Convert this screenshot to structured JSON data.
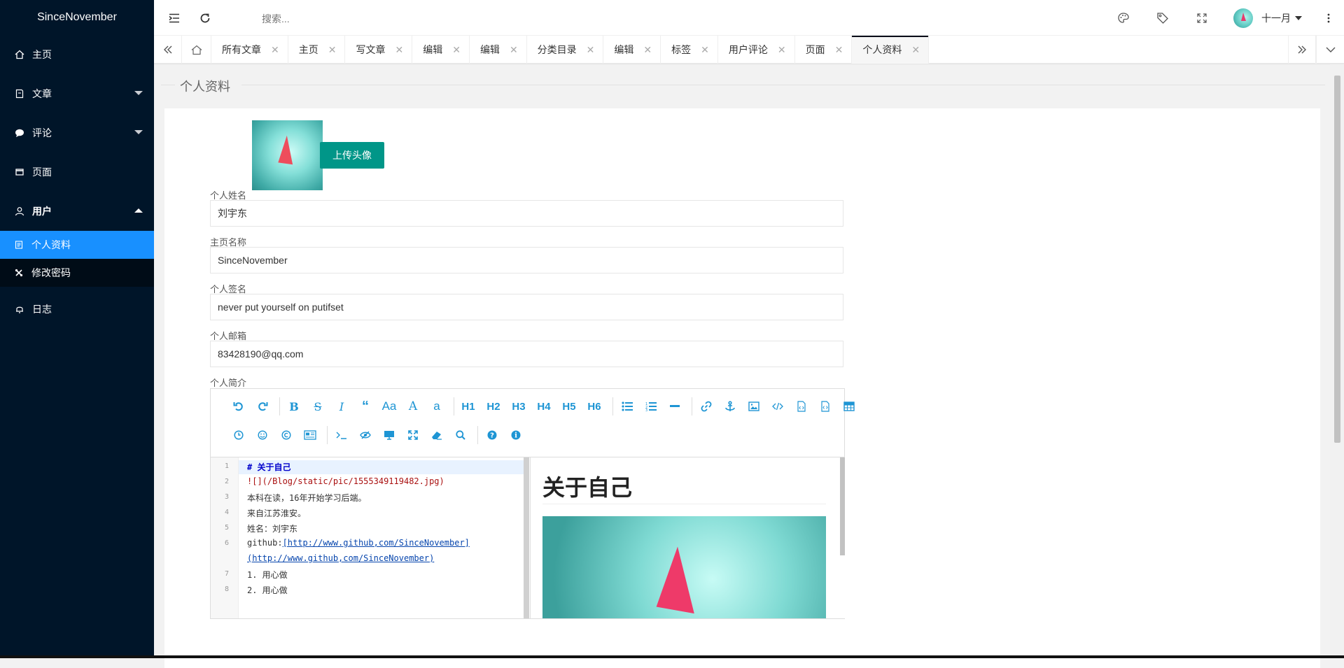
{
  "app": {
    "logo": "SinceNovember"
  },
  "sidebar": {
    "items": [
      {
        "label": "主页",
        "icon": "home-icon"
      },
      {
        "label": "文章",
        "icon": "article-icon",
        "expandable": true
      },
      {
        "label": "评论",
        "icon": "comment-icon",
        "expandable": true
      },
      {
        "label": "页面",
        "icon": "page-icon"
      },
      {
        "label": "用户",
        "icon": "user-icon",
        "expanded": true
      },
      {
        "label": "日志",
        "icon": "bell-icon"
      }
    ],
    "user_sub": [
      {
        "label": "个人资料",
        "icon": "profile-icon",
        "active": true
      },
      {
        "label": "修改密码",
        "icon": "tools-icon"
      }
    ]
  },
  "header": {
    "search_placeholder": "搜索...",
    "username": "十一月",
    "icons": [
      "menu-fold-icon",
      "refresh-icon",
      "palette-icon",
      "tag-icon",
      "fullscreen-icon",
      "more-icon"
    ]
  },
  "tabs": [
    {
      "label": "所有文章"
    },
    {
      "label": "主页"
    },
    {
      "label": "写文章"
    },
    {
      "label": "编辑"
    },
    {
      "label": "编辑"
    },
    {
      "label": "分类目录"
    },
    {
      "label": "编辑"
    },
    {
      "label": "标签"
    },
    {
      "label": "用户评论"
    },
    {
      "label": "页面"
    },
    {
      "label": "个人资料",
      "active": true
    }
  ],
  "page": {
    "title": "个人资料",
    "upload_button": "上传头像",
    "fields": {
      "name_label": "个人姓名",
      "name_value": "刘宇东",
      "homepage_label": "主页名称",
      "homepage_value": "SinceNovember",
      "signature_label": "个人签名",
      "signature_value": "never put yourself on putifset",
      "email_label": "个人邮箱",
      "email_value": "83428190@qq.com",
      "intro_label": "个人简介"
    }
  },
  "editor": {
    "toolbar_row1": [
      "undo-icon",
      "redo-icon",
      "|",
      "bold-icon",
      "strikethrough-icon",
      "italic-icon",
      "quote-icon",
      "uppercase-icon",
      "uppercase-first-icon",
      "lowercase-icon",
      "|",
      "H1",
      "H2",
      "H3",
      "H4",
      "H5",
      "H6",
      "|",
      "unordered-list-icon",
      "ordered-list-icon",
      "hr-icon",
      "|",
      "link-icon",
      "anchor-icon",
      "image-icon",
      "code-icon",
      "code-block-icon",
      "pre-block-icon",
      "table-icon"
    ],
    "toolbar_row2": [
      "datetime-icon",
      "emoji-icon",
      "html-entities-icon",
      "pagebreak-icon",
      "|",
      "terminal-icon",
      "eye-slash-icon",
      "desktop-icon",
      "expand-icon",
      "eraser-icon",
      "search-icon",
      "|",
      "help-icon",
      "info-icon"
    ],
    "heading_buttons": [
      "H1",
      "H2",
      "H3",
      "H4",
      "H5",
      "H6"
    ],
    "code_lines": {
      "l1": "# 关于自己",
      "l2": "![](/Blog/static/pic/1555349119482.jpg)",
      "l3": "本科在读，16年开始学习后端。",
      "l4": "来自江苏淮安。",
      "l5": "姓名：刘宇东",
      "l6a": "github:",
      "l6b": "[http://www.github,com/SinceNovember]",
      "l6c": "(http://www.github,com/SinceNovember)",
      "l7": "1. 用心做",
      "l8": "2. 用心做"
    },
    "line_numbers": [
      "1",
      "2",
      "3",
      "4",
      "5",
      "6",
      "7",
      "8"
    ],
    "preview_heading": "关于自己"
  },
  "colors": {
    "sidebar_bg": "#001529",
    "active": "#1890ff",
    "upload_button": "#009688",
    "toolbar_icon": "#1e95d4"
  }
}
